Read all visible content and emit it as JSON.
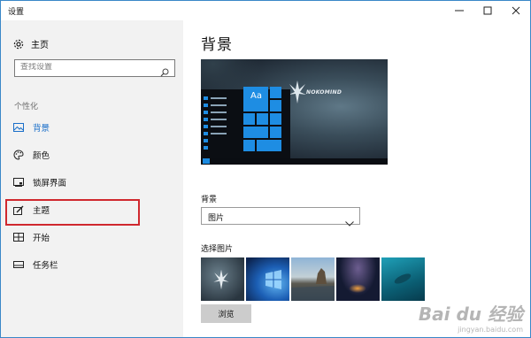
{
  "window": {
    "title": "设置",
    "controls": [
      "minimize-icon",
      "maximize-icon",
      "close-icon"
    ]
  },
  "sidebar": {
    "home_label": "主页",
    "search_placeholder": "查找设置",
    "category": "个性化",
    "items": [
      {
        "label": "背景",
        "icon": "picture-icon",
        "active": true
      },
      {
        "label": "颜色",
        "icon": "palette-icon",
        "active": false
      },
      {
        "label": "锁屏界面",
        "icon": "lockscreen-icon",
        "active": false
      },
      {
        "label": "主题",
        "icon": "theme-brush-icon",
        "active": false,
        "highlighted": true
      },
      {
        "label": "开始",
        "icon": "start-grid-icon",
        "active": false
      },
      {
        "label": "任务栏",
        "icon": "taskbar-icon",
        "active": false
      }
    ]
  },
  "main": {
    "heading": "背景",
    "preview": {
      "sample_text": "Aa",
      "logo_text": "NOKOMIND"
    },
    "background_label": "背景",
    "background_value": "图片",
    "choose_picture_label": "选择图片",
    "browse_label": "浏览"
  },
  "watermark": {
    "line1": "Bai du 经验",
    "line2": "jingyan.baidu.com"
  },
  "colors": {
    "accent": "#1a6fc9",
    "highlight_box": "#d0282e",
    "sidebar_bg": "#f2f2f2",
    "window_border": "#3a87c8"
  }
}
